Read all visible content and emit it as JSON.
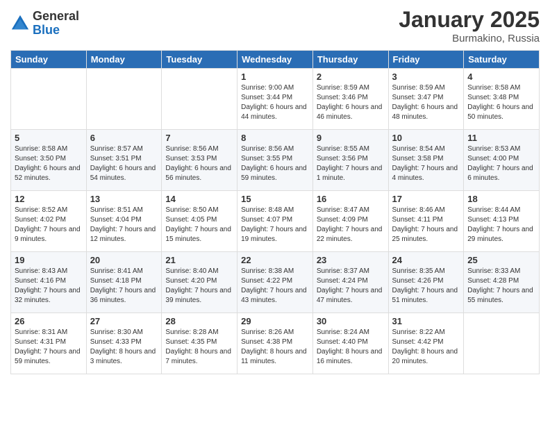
{
  "logo": {
    "general": "General",
    "blue": "Blue"
  },
  "header": {
    "month": "January 2025",
    "location": "Burmakino, Russia"
  },
  "weekdays": [
    "Sunday",
    "Monday",
    "Tuesday",
    "Wednesday",
    "Thursday",
    "Friday",
    "Saturday"
  ],
  "weeks": [
    [
      {
        "day": "",
        "sunrise": "",
        "sunset": "",
        "daylight": ""
      },
      {
        "day": "",
        "sunrise": "",
        "sunset": "",
        "daylight": ""
      },
      {
        "day": "",
        "sunrise": "",
        "sunset": "",
        "daylight": ""
      },
      {
        "day": "1",
        "sunrise": "Sunrise: 9:00 AM",
        "sunset": "Sunset: 3:44 PM",
        "daylight": "Daylight: 6 hours and 44 minutes."
      },
      {
        "day": "2",
        "sunrise": "Sunrise: 8:59 AM",
        "sunset": "Sunset: 3:46 PM",
        "daylight": "Daylight: 6 hours and 46 minutes."
      },
      {
        "day": "3",
        "sunrise": "Sunrise: 8:59 AM",
        "sunset": "Sunset: 3:47 PM",
        "daylight": "Daylight: 6 hours and 48 minutes."
      },
      {
        "day": "4",
        "sunrise": "Sunrise: 8:58 AM",
        "sunset": "Sunset: 3:48 PM",
        "daylight": "Daylight: 6 hours and 50 minutes."
      }
    ],
    [
      {
        "day": "5",
        "sunrise": "Sunrise: 8:58 AM",
        "sunset": "Sunset: 3:50 PM",
        "daylight": "Daylight: 6 hours and 52 minutes."
      },
      {
        "day": "6",
        "sunrise": "Sunrise: 8:57 AM",
        "sunset": "Sunset: 3:51 PM",
        "daylight": "Daylight: 6 hours and 54 minutes."
      },
      {
        "day": "7",
        "sunrise": "Sunrise: 8:56 AM",
        "sunset": "Sunset: 3:53 PM",
        "daylight": "Daylight: 6 hours and 56 minutes."
      },
      {
        "day": "8",
        "sunrise": "Sunrise: 8:56 AM",
        "sunset": "Sunset: 3:55 PM",
        "daylight": "Daylight: 6 hours and 59 minutes."
      },
      {
        "day": "9",
        "sunrise": "Sunrise: 8:55 AM",
        "sunset": "Sunset: 3:56 PM",
        "daylight": "Daylight: 7 hours and 1 minute."
      },
      {
        "day": "10",
        "sunrise": "Sunrise: 8:54 AM",
        "sunset": "Sunset: 3:58 PM",
        "daylight": "Daylight: 7 hours and 4 minutes."
      },
      {
        "day": "11",
        "sunrise": "Sunrise: 8:53 AM",
        "sunset": "Sunset: 4:00 PM",
        "daylight": "Daylight: 7 hours and 6 minutes."
      }
    ],
    [
      {
        "day": "12",
        "sunrise": "Sunrise: 8:52 AM",
        "sunset": "Sunset: 4:02 PM",
        "daylight": "Daylight: 7 hours and 9 minutes."
      },
      {
        "day": "13",
        "sunrise": "Sunrise: 8:51 AM",
        "sunset": "Sunset: 4:04 PM",
        "daylight": "Daylight: 7 hours and 12 minutes."
      },
      {
        "day": "14",
        "sunrise": "Sunrise: 8:50 AM",
        "sunset": "Sunset: 4:05 PM",
        "daylight": "Daylight: 7 hours and 15 minutes."
      },
      {
        "day": "15",
        "sunrise": "Sunrise: 8:48 AM",
        "sunset": "Sunset: 4:07 PM",
        "daylight": "Daylight: 7 hours and 19 minutes."
      },
      {
        "day": "16",
        "sunrise": "Sunrise: 8:47 AM",
        "sunset": "Sunset: 4:09 PM",
        "daylight": "Daylight: 7 hours and 22 minutes."
      },
      {
        "day": "17",
        "sunrise": "Sunrise: 8:46 AM",
        "sunset": "Sunset: 4:11 PM",
        "daylight": "Daylight: 7 hours and 25 minutes."
      },
      {
        "day": "18",
        "sunrise": "Sunrise: 8:44 AM",
        "sunset": "Sunset: 4:13 PM",
        "daylight": "Daylight: 7 hours and 29 minutes."
      }
    ],
    [
      {
        "day": "19",
        "sunrise": "Sunrise: 8:43 AM",
        "sunset": "Sunset: 4:16 PM",
        "daylight": "Daylight: 7 hours and 32 minutes."
      },
      {
        "day": "20",
        "sunrise": "Sunrise: 8:41 AM",
        "sunset": "Sunset: 4:18 PM",
        "daylight": "Daylight: 7 hours and 36 minutes."
      },
      {
        "day": "21",
        "sunrise": "Sunrise: 8:40 AM",
        "sunset": "Sunset: 4:20 PM",
        "daylight": "Daylight: 7 hours and 39 minutes."
      },
      {
        "day": "22",
        "sunrise": "Sunrise: 8:38 AM",
        "sunset": "Sunset: 4:22 PM",
        "daylight": "Daylight: 7 hours and 43 minutes."
      },
      {
        "day": "23",
        "sunrise": "Sunrise: 8:37 AM",
        "sunset": "Sunset: 4:24 PM",
        "daylight": "Daylight: 7 hours and 47 minutes."
      },
      {
        "day": "24",
        "sunrise": "Sunrise: 8:35 AM",
        "sunset": "Sunset: 4:26 PM",
        "daylight": "Daylight: 7 hours and 51 minutes."
      },
      {
        "day": "25",
        "sunrise": "Sunrise: 8:33 AM",
        "sunset": "Sunset: 4:28 PM",
        "daylight": "Daylight: 7 hours and 55 minutes."
      }
    ],
    [
      {
        "day": "26",
        "sunrise": "Sunrise: 8:31 AM",
        "sunset": "Sunset: 4:31 PM",
        "daylight": "Daylight: 7 hours and 59 minutes."
      },
      {
        "day": "27",
        "sunrise": "Sunrise: 8:30 AM",
        "sunset": "Sunset: 4:33 PM",
        "daylight": "Daylight: 8 hours and 3 minutes."
      },
      {
        "day": "28",
        "sunrise": "Sunrise: 8:28 AM",
        "sunset": "Sunset: 4:35 PM",
        "daylight": "Daylight: 8 hours and 7 minutes."
      },
      {
        "day": "29",
        "sunrise": "Sunrise: 8:26 AM",
        "sunset": "Sunset: 4:38 PM",
        "daylight": "Daylight: 8 hours and 11 minutes."
      },
      {
        "day": "30",
        "sunrise": "Sunrise: 8:24 AM",
        "sunset": "Sunset: 4:40 PM",
        "daylight": "Daylight: 8 hours and 16 minutes."
      },
      {
        "day": "31",
        "sunrise": "Sunrise: 8:22 AM",
        "sunset": "Sunset: 4:42 PM",
        "daylight": "Daylight: 8 hours and 20 minutes."
      },
      {
        "day": "",
        "sunrise": "",
        "sunset": "",
        "daylight": ""
      }
    ]
  ]
}
